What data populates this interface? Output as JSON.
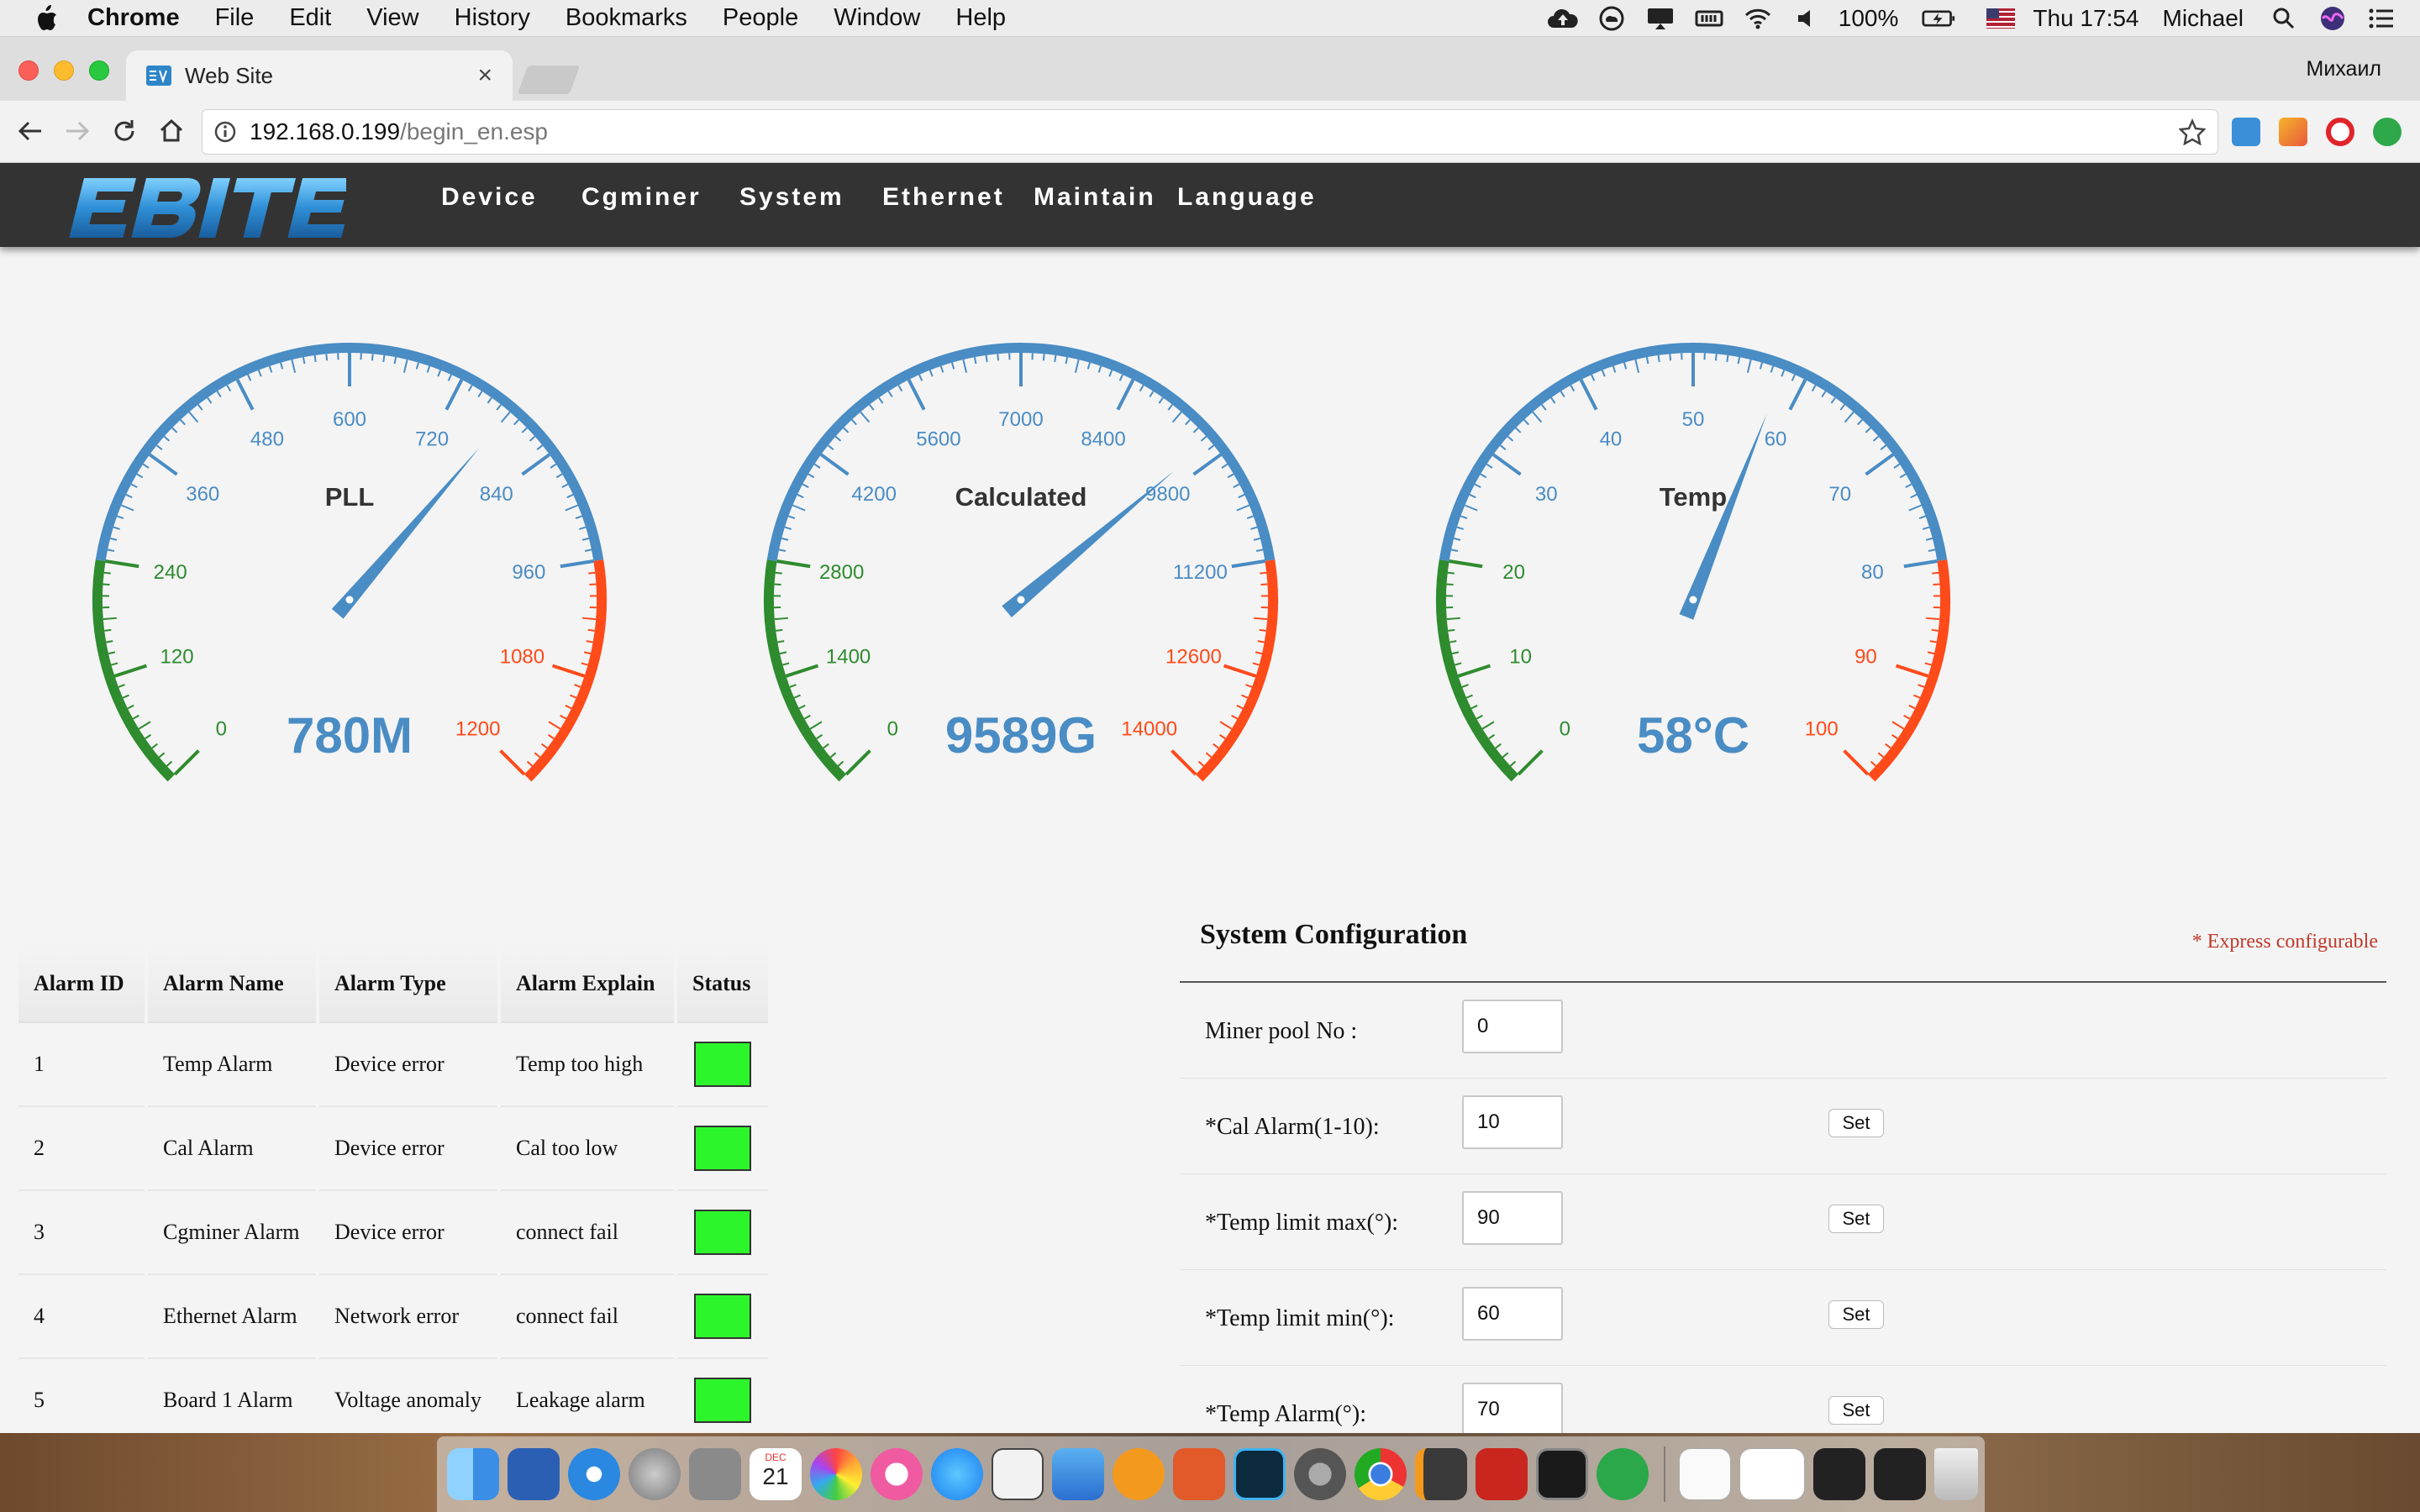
{
  "menubar": {
    "app": "Chrome",
    "menus": [
      "File",
      "Edit",
      "View",
      "History",
      "Bookmarks",
      "People",
      "Window",
      "Help"
    ],
    "battery": "100%",
    "clock": "Thu 17:54",
    "user": "Michael"
  },
  "browser": {
    "tab_title": "Web Site",
    "profile_name": "Михаил",
    "url_host": "192.168.0.199",
    "url_path": "/begin_en.esp"
  },
  "site": {
    "logo_text": "EBITE",
    "nav": [
      "Device",
      "Cgminer",
      "System",
      "Ethernet",
      "Maintain",
      "Language"
    ]
  },
  "gauges": [
    {
      "title": "PLL",
      "value": 780,
      "display": "780M",
      "max": 1200,
      "ticks": [
        "0",
        "120",
        "240",
        "360",
        "480",
        "600",
        "720",
        "840",
        "960",
        "1080",
        "1200"
      ]
    },
    {
      "title": "Calculated",
      "value": 9589,
      "display": "9589G",
      "max": 14000,
      "ticks": [
        "0",
        "1400",
        "2800",
        "4200",
        "5600",
        "7000",
        "8400",
        "9800",
        "11200",
        "12600",
        "14000"
      ]
    },
    {
      "title": "Temp",
      "value": 58,
      "display": "58°C",
      "max": 100,
      "ticks": [
        "0",
        "10",
        "20",
        "30",
        "40",
        "50",
        "60",
        "70",
        "80",
        "90",
        "100"
      ]
    }
  ],
  "gauge_colors": {
    "low": "#2e8b2e",
    "mid": "#4a8cc4",
    "high": "#ff4a1a"
  },
  "alarm_table": {
    "headers": [
      "Alarm ID",
      "Alarm Name",
      "Alarm Type",
      "Alarm Explain",
      "Status"
    ],
    "rows": [
      {
        "id": "1",
        "name": "Temp Alarm",
        "type": "Device error",
        "explain": "Temp too high",
        "status": "ok"
      },
      {
        "id": "2",
        "name": "Cal Alarm",
        "type": "Device error",
        "explain": "Cal too low",
        "status": "ok"
      },
      {
        "id": "3",
        "name": "Cgminer Alarm",
        "type": "Device error",
        "explain": "connect fail",
        "status": "ok"
      },
      {
        "id": "4",
        "name": "Ethernet Alarm",
        "type": "Network error",
        "explain": "connect fail",
        "status": "ok"
      },
      {
        "id": "5",
        "name": "Board 1 Alarm",
        "type": "Voltage anomaly",
        "explain": "Leakage alarm",
        "status": "ok"
      }
    ],
    "status_color": "#2cf52c"
  },
  "system_config": {
    "title": "System Configuration",
    "note": "* Express configurable",
    "set_label": "Set",
    "rows": [
      {
        "label": "Miner pool No :",
        "value": "0"
      },
      {
        "label": "*Cal Alarm(1-10):",
        "value": "10"
      },
      {
        "label": "*Temp limit max(°):",
        "value": "90"
      },
      {
        "label": "*Temp limit min(°):",
        "value": "60"
      },
      {
        "label": "*Temp Alarm(°):",
        "value": "70"
      }
    ]
  },
  "dock": {
    "calendar_month": "DEC",
    "calendar_day": "21",
    "apps": [
      "finder-icon",
      "word-icon",
      "safari-icon",
      "launchpad-icon",
      "calculator-icon",
      "calendar-icon",
      "photos-icon",
      "itunes-icon",
      "app-store-icon",
      "sketch-icon",
      "xcode-icon",
      "ibooks-icon",
      "remote-desktop-icon",
      "photoshop-icon",
      "system-preferences-icon",
      "chrome-icon",
      "sublime-text-icon",
      "filezilla-icon",
      "terminal-icon",
      "bitcoin-icon"
    ]
  }
}
